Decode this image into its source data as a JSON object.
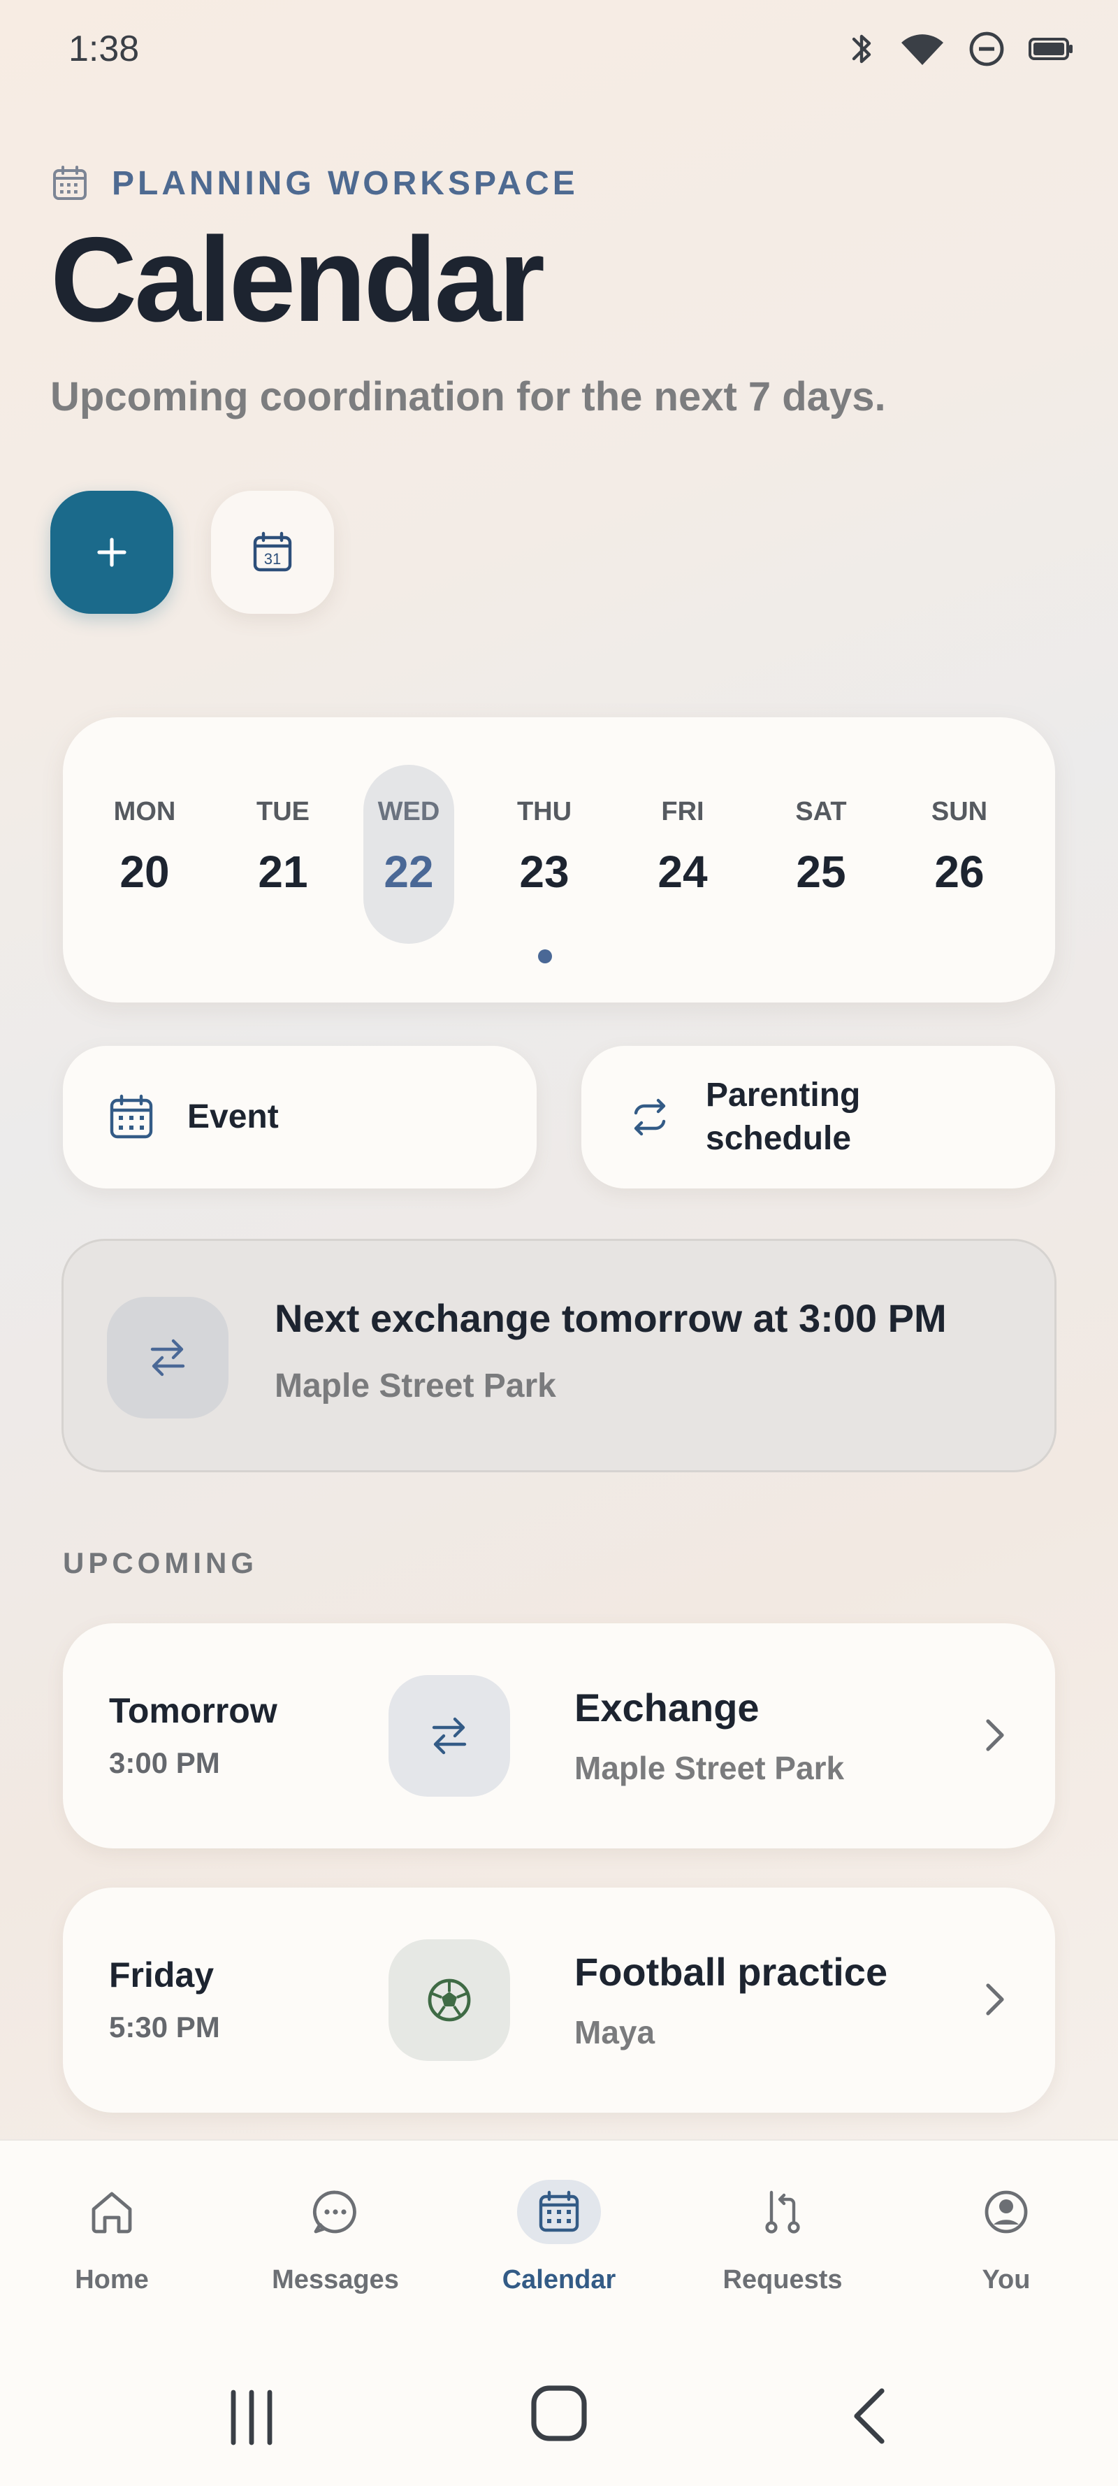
{
  "status_bar": {
    "time": "1:38"
  },
  "header": {
    "eyebrow": "PLANNING WORKSPACE",
    "title": "Calendar",
    "subtitle": "Upcoming coordination for the next 7 days."
  },
  "week": {
    "days": [
      {
        "name": "MON",
        "num": "20"
      },
      {
        "name": "TUE",
        "num": "21"
      },
      {
        "name": "WED",
        "num": "22",
        "selected": true
      },
      {
        "name": "THU",
        "num": "23",
        "has_event": true
      },
      {
        "name": "FRI",
        "num": "24"
      },
      {
        "name": "SAT",
        "num": "25"
      },
      {
        "name": "SUN",
        "num": "26"
      }
    ]
  },
  "quick_actions": {
    "event_label": "Event",
    "schedule_label_line1": "Parenting",
    "schedule_label_line2": "schedule"
  },
  "banner": {
    "title": "Next exchange tomorrow at 3:00 PM",
    "subtitle": "Maple Street Park"
  },
  "upcoming": {
    "label": "UPCOMING",
    "items": [
      {
        "day": "Tomorrow",
        "time": "3:00 PM",
        "title": "Exchange",
        "subtitle": "Maple Street Park",
        "icon": "swap-icon"
      },
      {
        "day": "Friday",
        "time": "5:30 PM",
        "title": "Football practice",
        "subtitle": "Maya",
        "icon": "soccer-ball-icon"
      }
    ]
  },
  "nav": {
    "items": [
      {
        "label": "Home",
        "icon": "home-icon"
      },
      {
        "label": "Messages",
        "icon": "chat-icon"
      },
      {
        "label": "Calendar",
        "icon": "calendar-icon",
        "active": true
      },
      {
        "label": "Requests",
        "icon": "pull-request-icon"
      },
      {
        "label": "You",
        "icon": "user-icon"
      }
    ]
  },
  "colors": {
    "accent": "#1b6a8b",
    "active_nav": "#335b86",
    "selected_day": "#4a6896"
  }
}
